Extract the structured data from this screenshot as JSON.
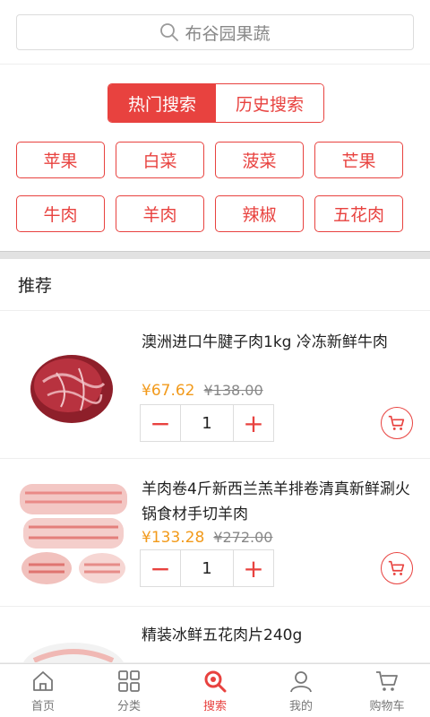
{
  "search": {
    "placeholder_text": "布谷园果蔬"
  },
  "tabs": [
    {
      "label": "热门搜索",
      "active": true
    },
    {
      "label": "历史搜索",
      "active": false
    }
  ],
  "hot_keywords": [
    "苹果",
    "白菜",
    "菠菜",
    "芒果",
    "牛肉",
    "羊肉",
    "辣椒",
    "五花肉"
  ],
  "recommend": {
    "title": "推荐"
  },
  "products": [
    {
      "name": "澳洲进口牛腱子肉1kg 冷冻新鲜牛肉",
      "price": "¥67.62",
      "old_price": "¥138.00",
      "qty": "1"
    },
    {
      "name": "羊肉卷4斤新西兰羔羊排卷清真新鲜涮火锅食材手切羊肉",
      "price": "¥133.28",
      "old_price": "¥272.00",
      "qty": "1"
    },
    {
      "name": "精装冰鲜五花肉片240g"
    }
  ],
  "nav": [
    {
      "label": "首页",
      "icon": "home-icon"
    },
    {
      "label": "分类",
      "icon": "grid-icon"
    },
    {
      "label": "搜索",
      "icon": "search-icon",
      "active": true
    },
    {
      "label": "我的",
      "icon": "user-icon"
    },
    {
      "label": "购物车",
      "icon": "cart-icon"
    }
  ],
  "colors": {
    "accent": "#e8423f",
    "price": "#f29a1b"
  }
}
